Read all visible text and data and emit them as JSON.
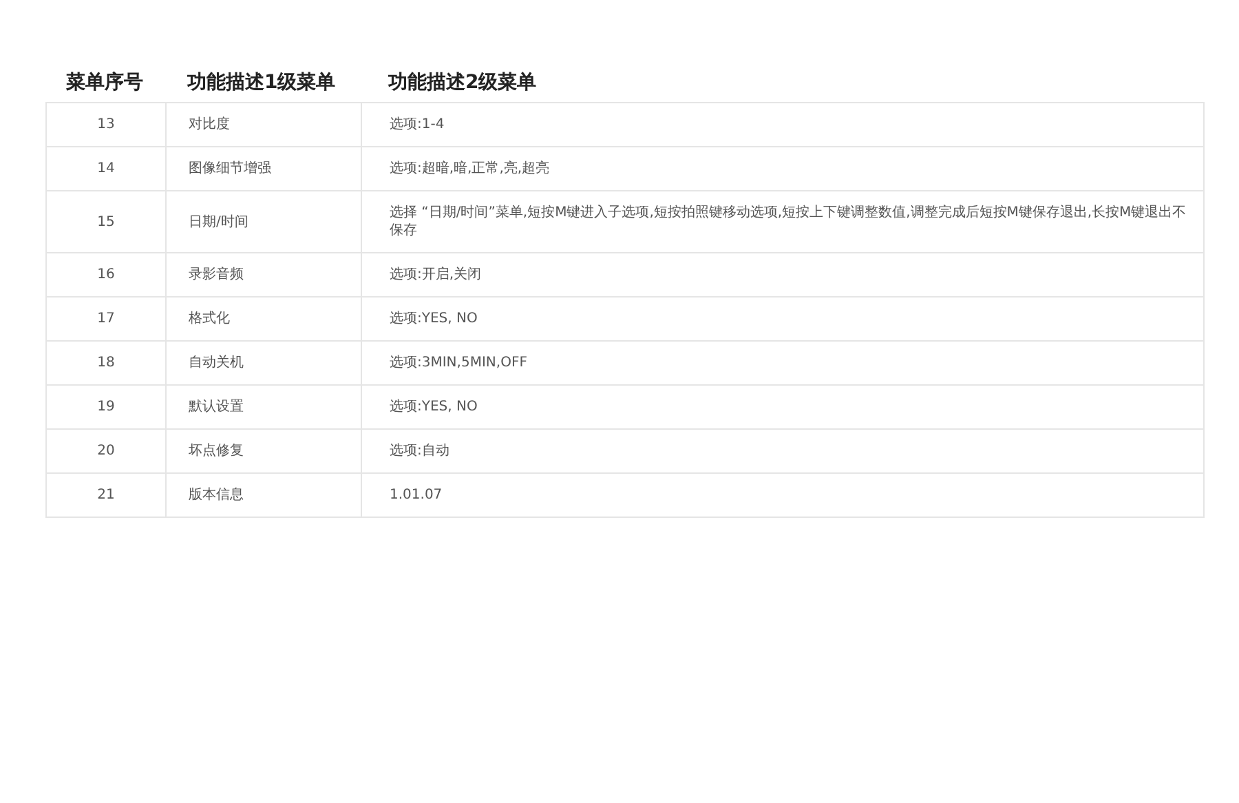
{
  "table": {
    "columns": [
      "菜单序号",
      "功能描述1级菜单",
      "功能描述2级菜单"
    ],
    "rows": [
      [
        "13",
        "对比度",
        "选项:1-4"
      ],
      [
        "14",
        "图像细节增强",
        "选项:超暗,暗,正常,亮,超亮"
      ],
      [
        "15",
        "日期/时间",
        "选择 “日期/时间”菜单,短按M键进入子选项,短按拍照键移动选项,短按上下键调整数值,调整完成后短按M键保存退出,长按M键退出不保存"
      ],
      [
        "16",
        "录影音频",
        "选项:开启,关闭"
      ],
      [
        "17",
        "格式化",
        "选项:YES, NO"
      ],
      [
        "18",
        "自动关机",
        "选项:3MIN,5MIN,OFF"
      ],
      [
        "19",
        "默认设置",
        "选项:YES, NO"
      ],
      [
        "20",
        "坏点修复",
        "选项:自动"
      ],
      [
        "21",
        "版本信息",
        "1.01.07"
      ]
    ]
  }
}
